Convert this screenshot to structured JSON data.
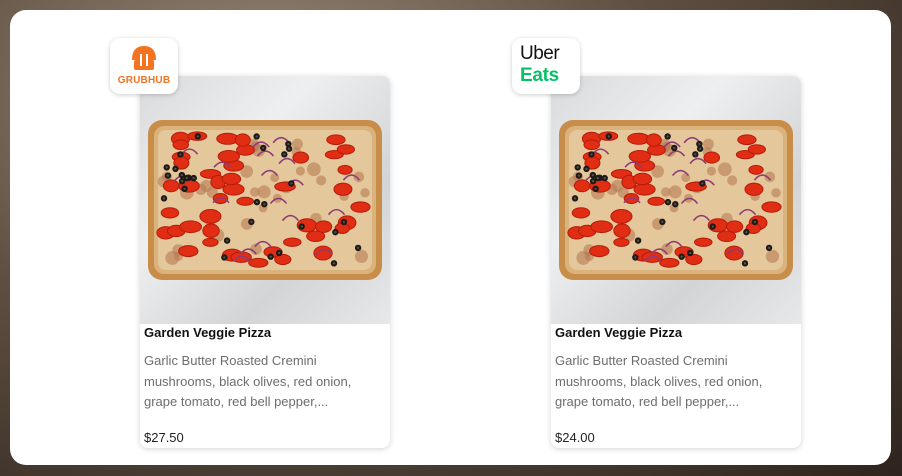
{
  "grubhub": {
    "logo_text": "GRUBHUB",
    "brand_color": "#f37321",
    "product": {
      "title": "Garden Veggie Pizza",
      "description": "Garlic Butter Roasted Cremini mushrooms, black olives, red onion, grape tomato, red bell pepper,...",
      "price": "$27.50"
    }
  },
  "ubereats": {
    "logo_word1": "Uber",
    "logo_word2": "Eats",
    "brand_color": "#06c167",
    "product": {
      "title": "Garden Veggie Pizza",
      "description": "Garlic Butter Roasted Cremini mushrooms, black olives, red onion, grape tomato, red bell pepper,...",
      "price": "$24.00"
    }
  }
}
